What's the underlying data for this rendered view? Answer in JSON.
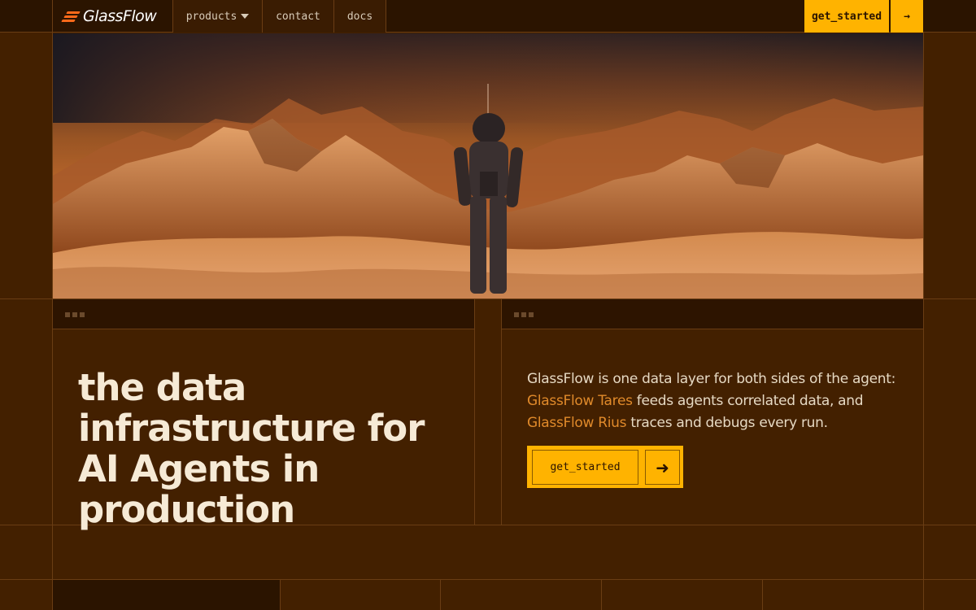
{
  "brand": {
    "name": "GlassFlow",
    "accent": "#ffb300",
    "logo_color": "#ff6a1a"
  },
  "nav": {
    "items": [
      {
        "label": "products",
        "has_dropdown": true
      },
      {
        "label": "contact"
      },
      {
        "label": "docs"
      }
    ],
    "cta_label": "get_started",
    "cta_icon": "arrow-right-icon"
  },
  "hero": {
    "image_alt_subject": "astronaut-on-mars-landscape",
    "headline": "the data infrastructure for AI Agents in production",
    "description_intro": "GlassFlow is one data layer for both sides of the agent: ",
    "product_one": "GlassFlow Tares",
    "product_one_text": " feeds agents correlated data, and ",
    "product_two": "GlassFlow Rius",
    "product_two_text": " traces and debugs every run.",
    "cta_label": "get_started",
    "cta_icon": "arrow-right-icon"
  }
}
